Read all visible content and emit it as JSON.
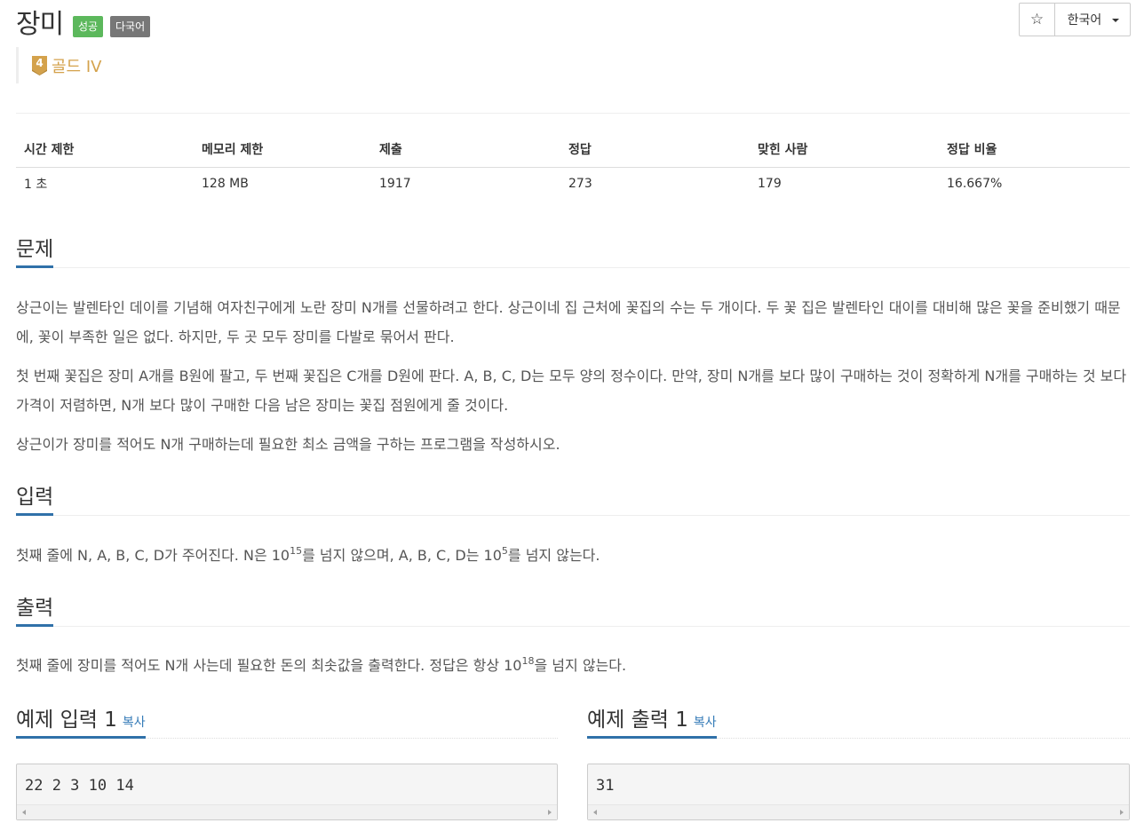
{
  "problem": {
    "title": "장미",
    "badges": {
      "success": "성공",
      "multilang": "다국어"
    },
    "tier": {
      "number": "4",
      "label": "골드 IV"
    }
  },
  "toolbar": {
    "star_icon": "☆",
    "language": "한국어"
  },
  "info": {
    "headers": [
      "시간 제한",
      "메모리 제한",
      "제출",
      "정답",
      "맞힌 사람",
      "정답 비율"
    ],
    "values": [
      "1 초",
      "128 MB",
      "1917",
      "273",
      "179",
      "16.667%"
    ]
  },
  "description": {
    "heading": "문제",
    "p1": "상근이는 발렌타인 데이를 기념해 여자친구에게 노란 장미 N개를 선물하려고 한다. 상근이네 집 근처에 꽃집의 수는 두 개이다. 두 꽃 집은 발렌타인 대이를 대비해 많은 꽃을 준비했기 때문에, 꽃이 부족한 일은 없다. 하지만, 두 곳 모두 장미를 다발로 묶어서 판다.",
    "p2": "첫 번째 꽃집은 장미 A개를 B원에 팔고, 두 번째 꽃집은 C개를 D원에 판다. A, B, C, D는 모두 양의 정수이다. 만약, 장미 N개를 보다 많이 구매하는 것이 정확하게 N개를 구매하는 것 보다 가격이 저렴하면, N개 보다 많이 구매한 다음 남은 장미는 꽃집 점원에게 줄 것이다.",
    "p3": "상근이가 장미를 적어도 N개 구매하는데 필요한 최소 금액을 구하는 프로그램을 작성하시오."
  },
  "input": {
    "heading": "입력",
    "t1": "첫째 줄에 N, A, B, C, D가 주어진다. N은 10",
    "sup1": "15",
    "t2": "를 넘지 않으며, A, B, C, D는 10",
    "sup2": "5",
    "t3": "를 넘지 않는다."
  },
  "output": {
    "heading": "출력",
    "t1": "첫째 줄에 장미를 적어도 N개 사는데 필요한 돈의 최솟값을 출력한다. 정답은 항상 10",
    "sup1": "18",
    "t2": "을 넘지 않는다."
  },
  "samples": {
    "input_heading": "예제 입력 1",
    "output_heading": "예제 출력 1",
    "copy_label": "복사",
    "input_value": "22 2 3 10 14",
    "output_value": "31"
  },
  "colors": {
    "success": "#5cb85c",
    "multilang": "#777777",
    "tier_gold": "#d4a24c",
    "underline": "#3071a9",
    "link": "#337ab7"
  }
}
